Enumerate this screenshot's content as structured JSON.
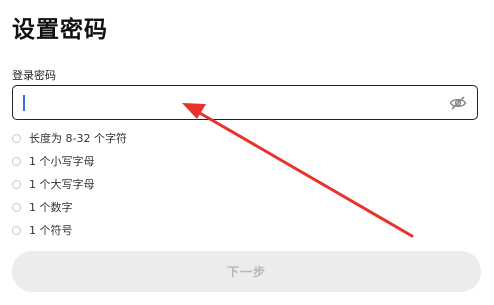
{
  "title": "设置密码",
  "password_field": {
    "label": "登录密码",
    "value": "",
    "placeholder": "",
    "toggle_icon": "eye-off-icon"
  },
  "requirements": [
    {
      "text": "长度为 8-32 个字符",
      "met": false
    },
    {
      "text": "1 个小写字母",
      "met": false
    },
    {
      "text": "1 个大写字母",
      "met": false
    },
    {
      "text": "1 个数字",
      "met": false
    },
    {
      "text": "1 个符号",
      "met": false
    }
  ],
  "next_button": {
    "label": "下一步",
    "enabled": false
  },
  "colors": {
    "caret": "#3b6fe0",
    "annotation_arrow": "#e8322a",
    "disabled_button_bg": "#ececec",
    "disabled_button_text": "#b5b5b5"
  }
}
